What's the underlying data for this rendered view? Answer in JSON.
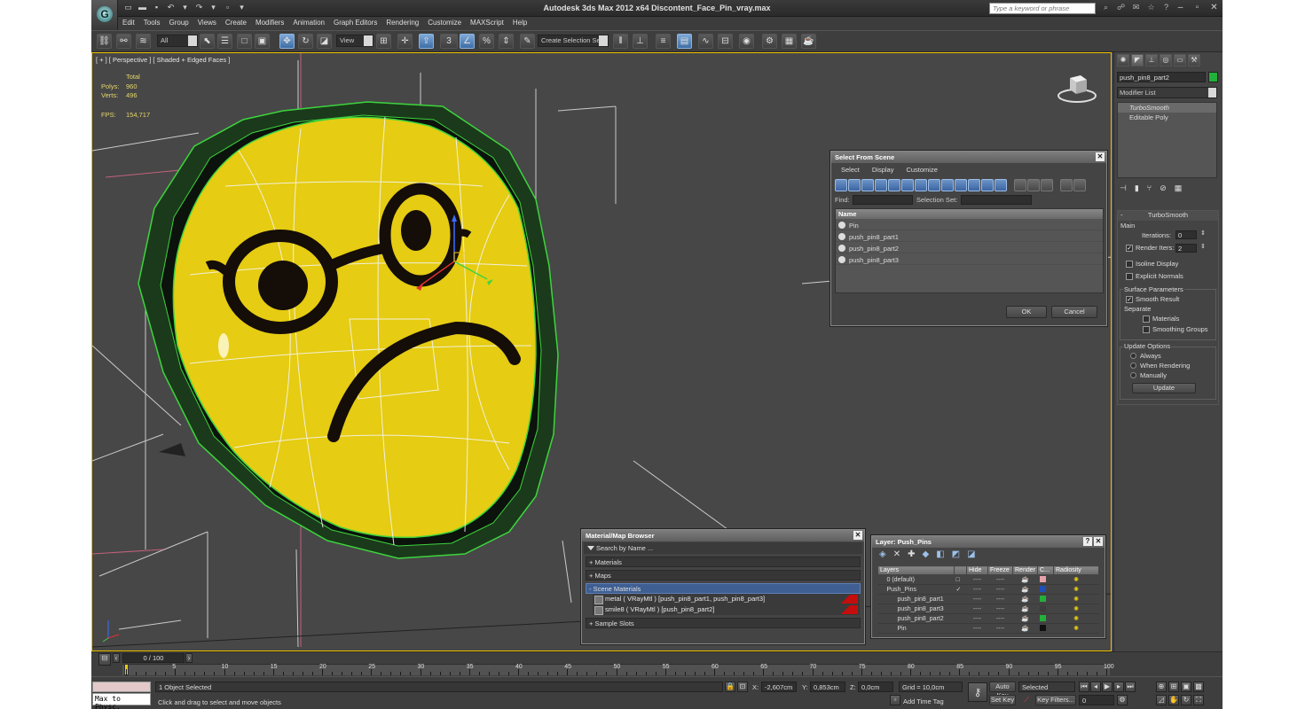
{
  "window": {
    "title": "Autodesk 3ds Max  2012 x64    Discontent_Face_Pin_vray.max",
    "search_placeholder": "Type a keyword or phrase"
  },
  "menu": [
    "Edit",
    "Tools",
    "Group",
    "Views",
    "Create",
    "Modifiers",
    "Animation",
    "Graph Editors",
    "Rendering",
    "Customize",
    "MAXScript",
    "Help"
  ],
  "toolbar": {
    "filter_value": "All",
    "refcoord_value": "View",
    "selection_set_placeholder": "Create Selection Se",
    "snap_label": "3"
  },
  "viewport": {
    "label": "[ + ] [ Perspective ] [ Shaded + Edged Faces ]",
    "stats_header": "Total",
    "polys_label": "Polys:",
    "polys_value": "960",
    "verts_label": "Verts:",
    "verts_value": "496",
    "fps_label": "FPS:",
    "fps_value": "154,717"
  },
  "select_from_scene": {
    "title": "Select From Scene",
    "menu": [
      "Select",
      "Display",
      "Customize"
    ],
    "find_label": "Find:",
    "selection_set_label": "Selection Set:",
    "column_name": "Name",
    "items": [
      "Pin",
      "push_pin8_part1",
      "push_pin8_part2",
      "push_pin8_part3"
    ],
    "ok_label": "OK",
    "cancel_label": "Cancel"
  },
  "material_browser": {
    "title": "Material/Map Browser",
    "search_placeholder": "Search by Name ...",
    "groups": {
      "materials": "+ Materials",
      "maps": "+ Maps",
      "scene_materials": "- Scene Materials",
      "sample_slots": "+ Sample Slots"
    },
    "scene_items": [
      "metal  ( VRayMtl ) [push_pin8_part1, push_pin8_part3]",
      "smile8  ( VRayMtl ) [push_pin8_part2]"
    ]
  },
  "layers": {
    "title": "Layer: Push_Pins",
    "columns": [
      "Layers",
      "Hide",
      "Freeze",
      "Render",
      "C...",
      "Radiosity"
    ],
    "rows": [
      {
        "name": "0 (default)",
        "color": "#e7a1a8"
      },
      {
        "name": "Push_Pins",
        "color": "#1f4fb6"
      },
      {
        "name": "push_pin8_part1",
        "color": "#22b03a"
      },
      {
        "name": "push_pin8_part3",
        "color": "#3c3c3c"
      },
      {
        "name": "push_pin8_part2",
        "color": "#22b03a"
      },
      {
        "name": "Pin",
        "color": "#111111"
      }
    ]
  },
  "command_panel": {
    "object_name": "push_pin8_part2",
    "object_color": "#22b03a",
    "modifier_list": "Modifier List",
    "stack": [
      "TurboSmooth",
      "Editable Poly"
    ],
    "turbosmooth": {
      "title": "TurboSmooth",
      "main": "Main",
      "iterations_label": "Iterations:",
      "iterations_value": "0",
      "render_iters_label": "Render Iters:",
      "render_iters_value": "2",
      "isoline_display": "Isoline Display",
      "explicit_normals": "Explicit Normals",
      "surface_parameters": "Surface Parameters",
      "smooth_result": "Smooth Result",
      "separate": "Separate",
      "materials": "Materials",
      "smoothing_groups": "Smoothing Groups",
      "update_options": "Update Options",
      "always": "Always",
      "when_rendering": "When Rendering",
      "manually": "Manually",
      "update_button": "Update"
    }
  },
  "timeline": {
    "slider": "0 / 100",
    "ticks": [
      "5",
      "10",
      "15",
      "20",
      "25",
      "30",
      "35",
      "40",
      "45",
      "50",
      "55",
      "60",
      "65",
      "70",
      "75",
      "80",
      "85",
      "90",
      "95",
      "100"
    ]
  },
  "status": {
    "maxscript_label": "Max to Physc.",
    "objects_selected": "1 Object Selected",
    "prompt": "Click and drag to select and move objects",
    "x_label": "X:",
    "x_value": "-2,607cm",
    "y_label": "Y:",
    "y_value": "0,853cm",
    "z_label": "Z:",
    "z_value": "0,0cm",
    "grid": "Grid = 10,0cm",
    "add_time_tag": "Add Time Tag",
    "auto_key": "Auto Key",
    "set_key": "Set Key",
    "selected_value": "Selected",
    "key_filters": "Key Filters...",
    "frame_value": "0"
  }
}
